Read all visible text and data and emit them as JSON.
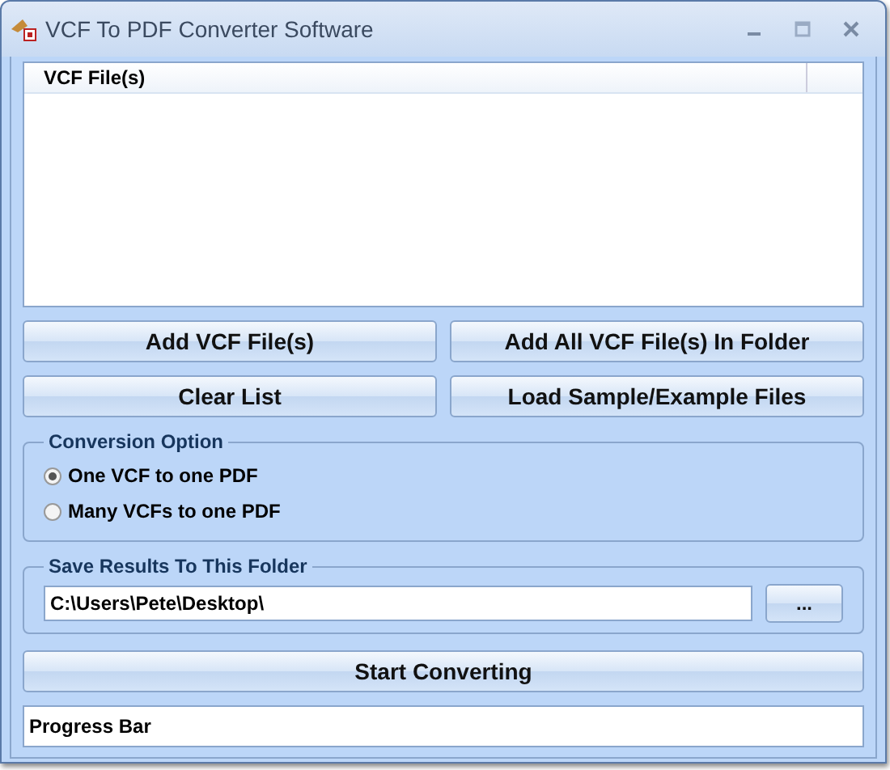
{
  "window": {
    "title": "VCF To PDF Converter Software"
  },
  "file_list": {
    "columns": [
      "VCF File(s)"
    ]
  },
  "buttons": [
    "Add VCF File(s)",
    "Add All VCF File(s) In Folder",
    "Clear List",
    "Load Sample/Example Files"
  ],
  "conversion_option": {
    "title": "Conversion Option",
    "options": [
      {
        "label": "One VCF to one PDF",
        "selected": true
      },
      {
        "label": "Many VCFs to one PDF",
        "selected": false
      }
    ]
  },
  "save_folder": {
    "title": "Save Results To This Folder",
    "value": "C:\\Users\\Pete\\Desktop\\",
    "browse_button": "..."
  },
  "start_button": "Start Converting",
  "progress_bar": {
    "label": "Progress Bar"
  }
}
